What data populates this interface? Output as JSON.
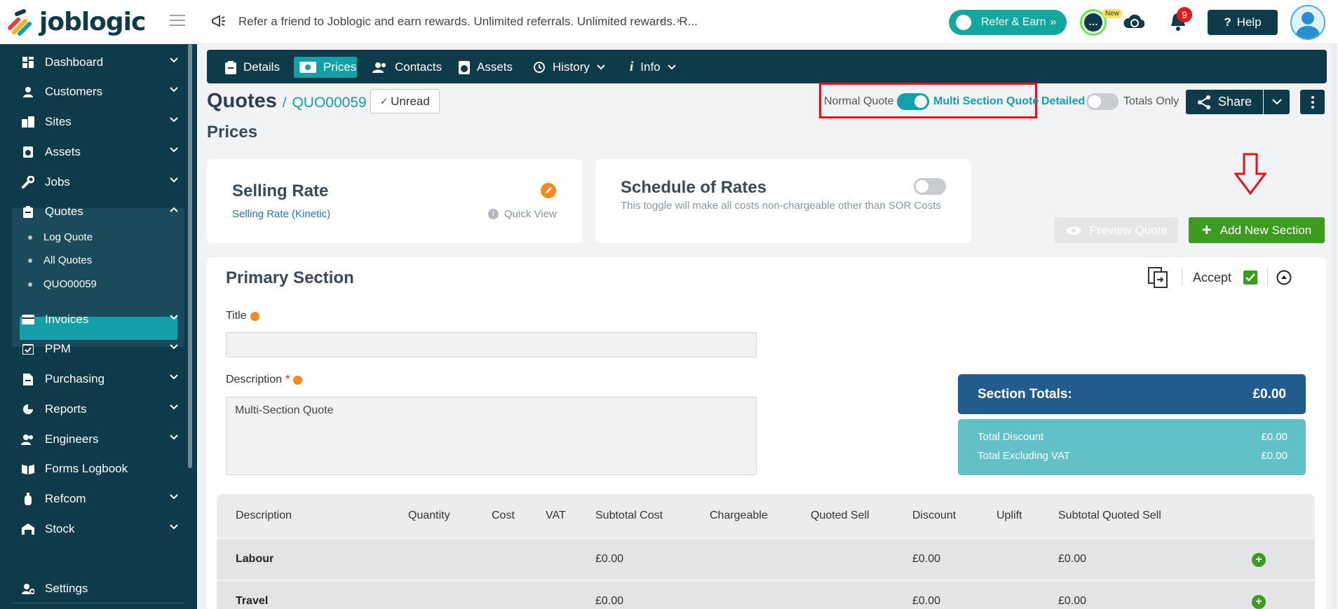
{
  "header": {
    "logo_text": "joblogic",
    "announcement": "Refer a friend to Joblogic and earn rewards. Unlimited referrals. Unlimited rewards. R...",
    "refer_label": "Refer & Earn",
    "chat_new_badge": "New",
    "notification_count": "9",
    "help_label": "Help"
  },
  "sidebar": {
    "items": [
      {
        "label": "Dashboard"
      },
      {
        "label": "Customers"
      },
      {
        "label": "Sites"
      },
      {
        "label": "Assets"
      },
      {
        "label": "Jobs"
      },
      {
        "label": "Quotes"
      },
      {
        "label": "Invoices"
      },
      {
        "label": "PPM"
      },
      {
        "label": "Purchasing"
      },
      {
        "label": "Reports"
      },
      {
        "label": "Engineers"
      },
      {
        "label": "Forms Logbook"
      },
      {
        "label": "Refcom"
      },
      {
        "label": "Stock"
      }
    ],
    "quotes_sub": [
      {
        "label": "Log Quote"
      },
      {
        "label": "All Quotes"
      },
      {
        "label": "QUO00059"
      }
    ],
    "settings_label": "Settings"
  },
  "tabs": [
    {
      "label": "Details"
    },
    {
      "label": "Prices"
    },
    {
      "label": "Contacts"
    },
    {
      "label": "Assets"
    },
    {
      "label": "History"
    },
    {
      "label": "Info"
    }
  ],
  "breadcrumb": {
    "title": "Quotes",
    "separator": "/",
    "code": "QUO00059"
  },
  "unread_label": "Unread",
  "page_subtitle": "Prices",
  "quote_mode": {
    "normal_label": "Normal Quote",
    "multi_label": "Multi Section Quote",
    "multi_enabled": true,
    "detailed_label": "Detailed",
    "totals_only_label": "Totals Only",
    "totals_only_enabled": false
  },
  "share_label": "Share",
  "selling_rate": {
    "title": "Selling Rate",
    "link": "Selling Rate (Kinetic)",
    "quick_view": "Quick View"
  },
  "schedule_of_rates": {
    "title": "Schedule of Rates",
    "description": "This toggle will make all costs non-chargeable other than SOR Costs",
    "enabled": false
  },
  "buttons": {
    "preview_quote": "Preview Quote",
    "add_new_section": "Add New Section"
  },
  "section": {
    "title": "Primary Section",
    "accept_label": "Accept",
    "accept_checked": true,
    "title_field_label": "Title",
    "title_value": "",
    "description_label": "Description",
    "required_mark": "*",
    "description_value": "Multi-Section Quote"
  },
  "totals": {
    "heading": "Section Totals:",
    "heading_value": "£0.00",
    "discount_label": "Total Discount",
    "discount_value": "£0.00",
    "excl_vat_label": "Total Excluding VAT",
    "excl_vat_value": "£0.00"
  },
  "table": {
    "headers": [
      "Description",
      "Quantity",
      "Cost",
      "VAT",
      "Subtotal Cost",
      "Chargeable",
      "Quoted Sell",
      "Discount",
      "Uplift",
      "Subtotal Quoted Sell"
    ],
    "rows": [
      {
        "description": "Labour",
        "subtotal_cost": "£0.00",
        "discount": "£0.00",
        "subtotal_quoted_sell": "£0.00"
      },
      {
        "description": "Travel",
        "subtotal_cost": "£0.00",
        "discount": "£0.00",
        "subtotal_quoted_sell": "£0.00"
      }
    ]
  },
  "colors": {
    "brand_dark": "#0e3a4a",
    "accent_teal": "#13a0a8",
    "add_green": "#3d9b1f",
    "highlight_red": "#e0141e"
  }
}
